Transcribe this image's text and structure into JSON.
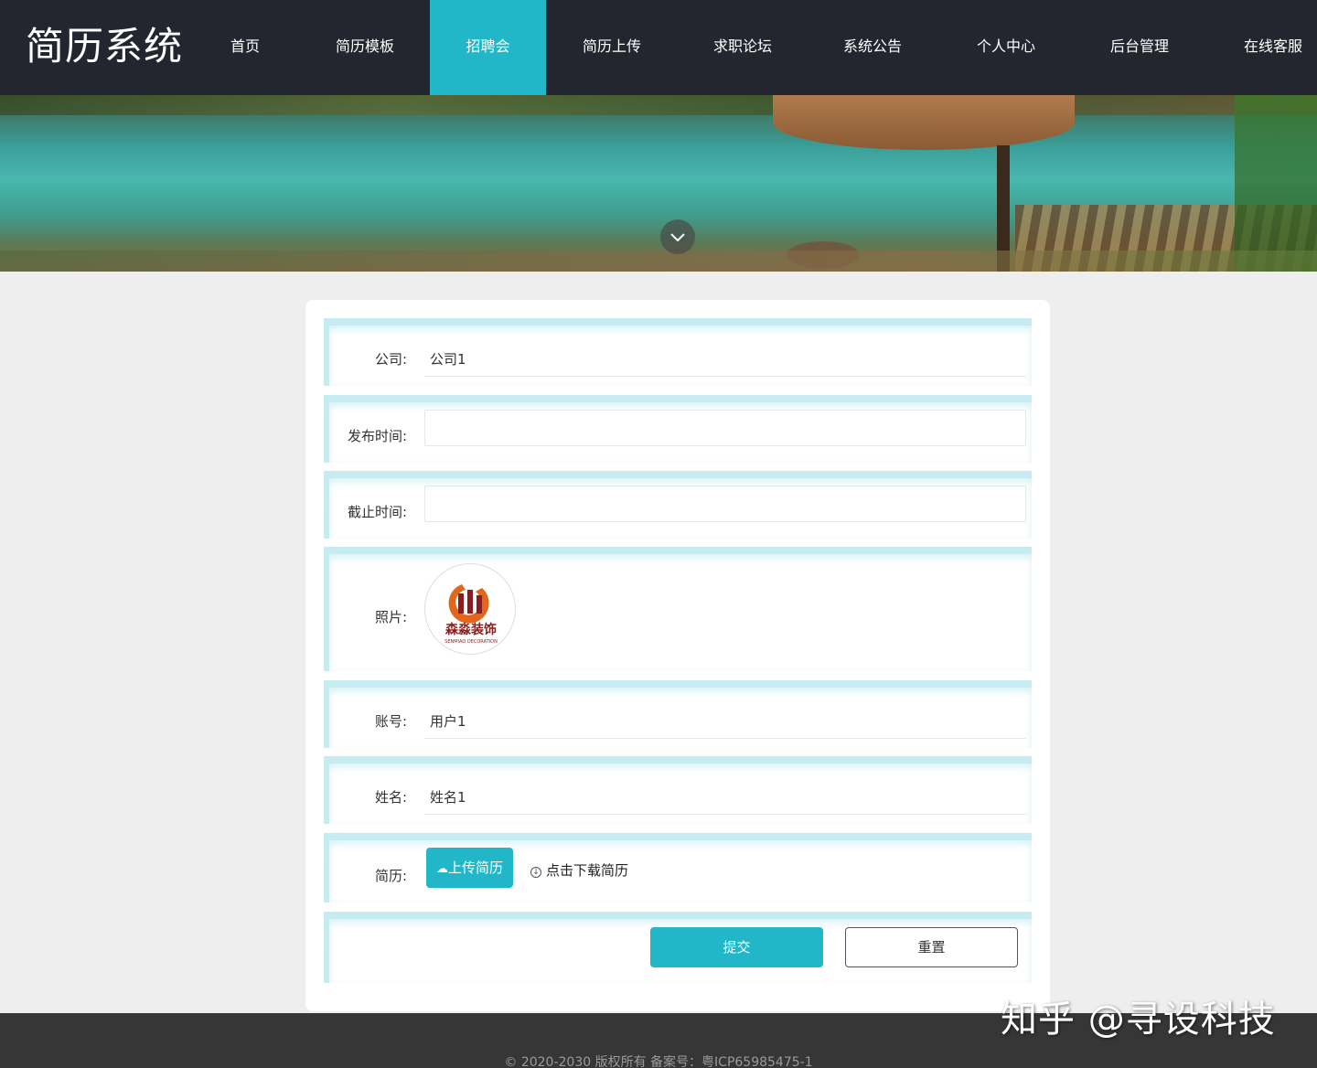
{
  "app": {
    "title": "简历系统"
  },
  "nav": {
    "items": [
      {
        "label": "首页",
        "active": false
      },
      {
        "label": "简历模板",
        "active": false
      },
      {
        "label": "招聘会",
        "active": true
      },
      {
        "label": "简历上传",
        "active": false
      },
      {
        "label": "求职论坛",
        "active": false
      },
      {
        "label": "系统公告",
        "active": false
      },
      {
        "label": "个人中心",
        "active": false
      },
      {
        "label": "后台管理",
        "active": false
      },
      {
        "label": "在线客服",
        "active": false
      }
    ]
  },
  "banner": {
    "scroll_icon": "chevron-down-icon"
  },
  "form": {
    "company": {
      "label": "公司:",
      "value": "公司1"
    },
    "publish_time": {
      "label": "发布时间:",
      "value": ""
    },
    "deadline": {
      "label": "截止时间:",
      "value": ""
    },
    "photo": {
      "label": "照片:",
      "logo_text": "森淼装饰",
      "logo_subtext": "SENMIAO DECORATION"
    },
    "account": {
      "label": "账号:",
      "value": "用户1"
    },
    "name": {
      "label": "姓名:",
      "value": "姓名1"
    },
    "resume": {
      "label": "简历:",
      "upload_label": "上传简历",
      "download_label": "点击下载简历"
    },
    "submit_label": "提交",
    "reset_label": "重置"
  },
  "footer": {
    "text": "© 2020-2030 版权所有 备案号：粤ICP65985475-1"
  },
  "watermark": "知乎 @寻设科技",
  "colors": {
    "accent": "#22b6c9",
    "nav_bg": "#23262f",
    "footer_bg": "#363636",
    "row_border": "#c6ebf0"
  }
}
